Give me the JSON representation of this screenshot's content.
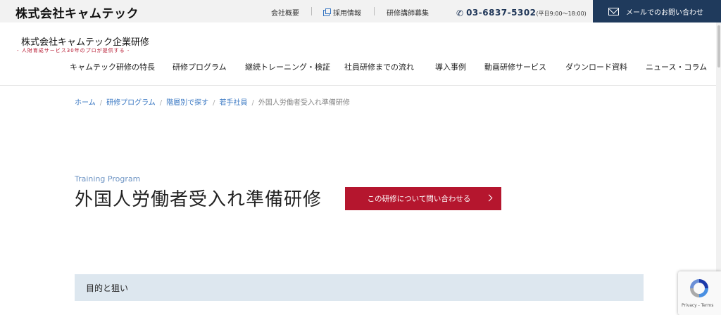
{
  "top_bar": {
    "brand": "株式会社キャムテック",
    "links": [
      "会社概要",
      "採用情報",
      "研修講師募集"
    ],
    "phone_number": "03-6837-5302",
    "phone_hours": "(平日9:00～18:00)",
    "mail_button_label": "メールでのお問い合わせ"
  },
  "header": {
    "site_name": "株式会社キャムテック企業研修",
    "tagline": "- 人財育成サービス30年のプロが提供する -",
    "nav": [
      "キャムテック研修の特長",
      "研修プログラム",
      "継続トレーニング・検証",
      "社員研修までの流れ",
      "導入事例",
      "動画研修サービス",
      "ダウンロード資料",
      "ニュース・コラム"
    ]
  },
  "breadcrumb": {
    "items": [
      "ホーム",
      "研修プログラム",
      "階層別で探す",
      "若手社員"
    ],
    "separator": "/",
    "current": "外国人労働者受入れ準備研修"
  },
  "main": {
    "eyebrow": "Training Program",
    "title": "外国人労働者受入れ準備研修",
    "cta_label": "この研修について問い合わせる",
    "section_heading": "目的と狙い"
  },
  "recaptcha": {
    "text": "Privacy - Terms"
  },
  "colors": {
    "navy": "#1f3a5c",
    "accent_red": "#b5162e",
    "link_blue": "#3a78c3",
    "section_bg": "#dde7ef"
  }
}
